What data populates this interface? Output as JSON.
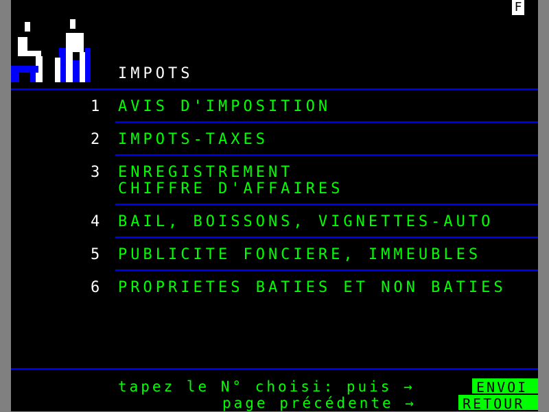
{
  "corner_letter": "F",
  "page_title": "IMPOTS",
  "menu": [
    {
      "num": "1",
      "line1": "AVIS D'IMPOSITION",
      "line2": ""
    },
    {
      "num": "2",
      "line1": "IMPOTS-TAXES",
      "line2": ""
    },
    {
      "num": "3",
      "line1": "ENREGISTREMENT",
      "line2": "CHIFFRE D'AFFAIRES"
    },
    {
      "num": "4",
      "line1": "BAIL, BOISSONS, VIGNETTES-AUTO",
      "line2": ""
    },
    {
      "num": "5",
      "line1": "PUBLICITE FONCIERE, IMMEUBLES",
      "line2": ""
    },
    {
      "num": "6",
      "line1": "PROPRIETES BATIES ET NON BATIES",
      "line2": ""
    }
  ],
  "footer": {
    "prompt": "tapez le N° choisi: puis →",
    "envoi_label": "ENVOI",
    "back_prompt": "page précédente →",
    "retour_label": "RETOUR"
  },
  "colors": {
    "background": "#000000",
    "text_green": "#00ff00",
    "rule_blue": "#0000ff",
    "title_white": "#ffffff"
  }
}
